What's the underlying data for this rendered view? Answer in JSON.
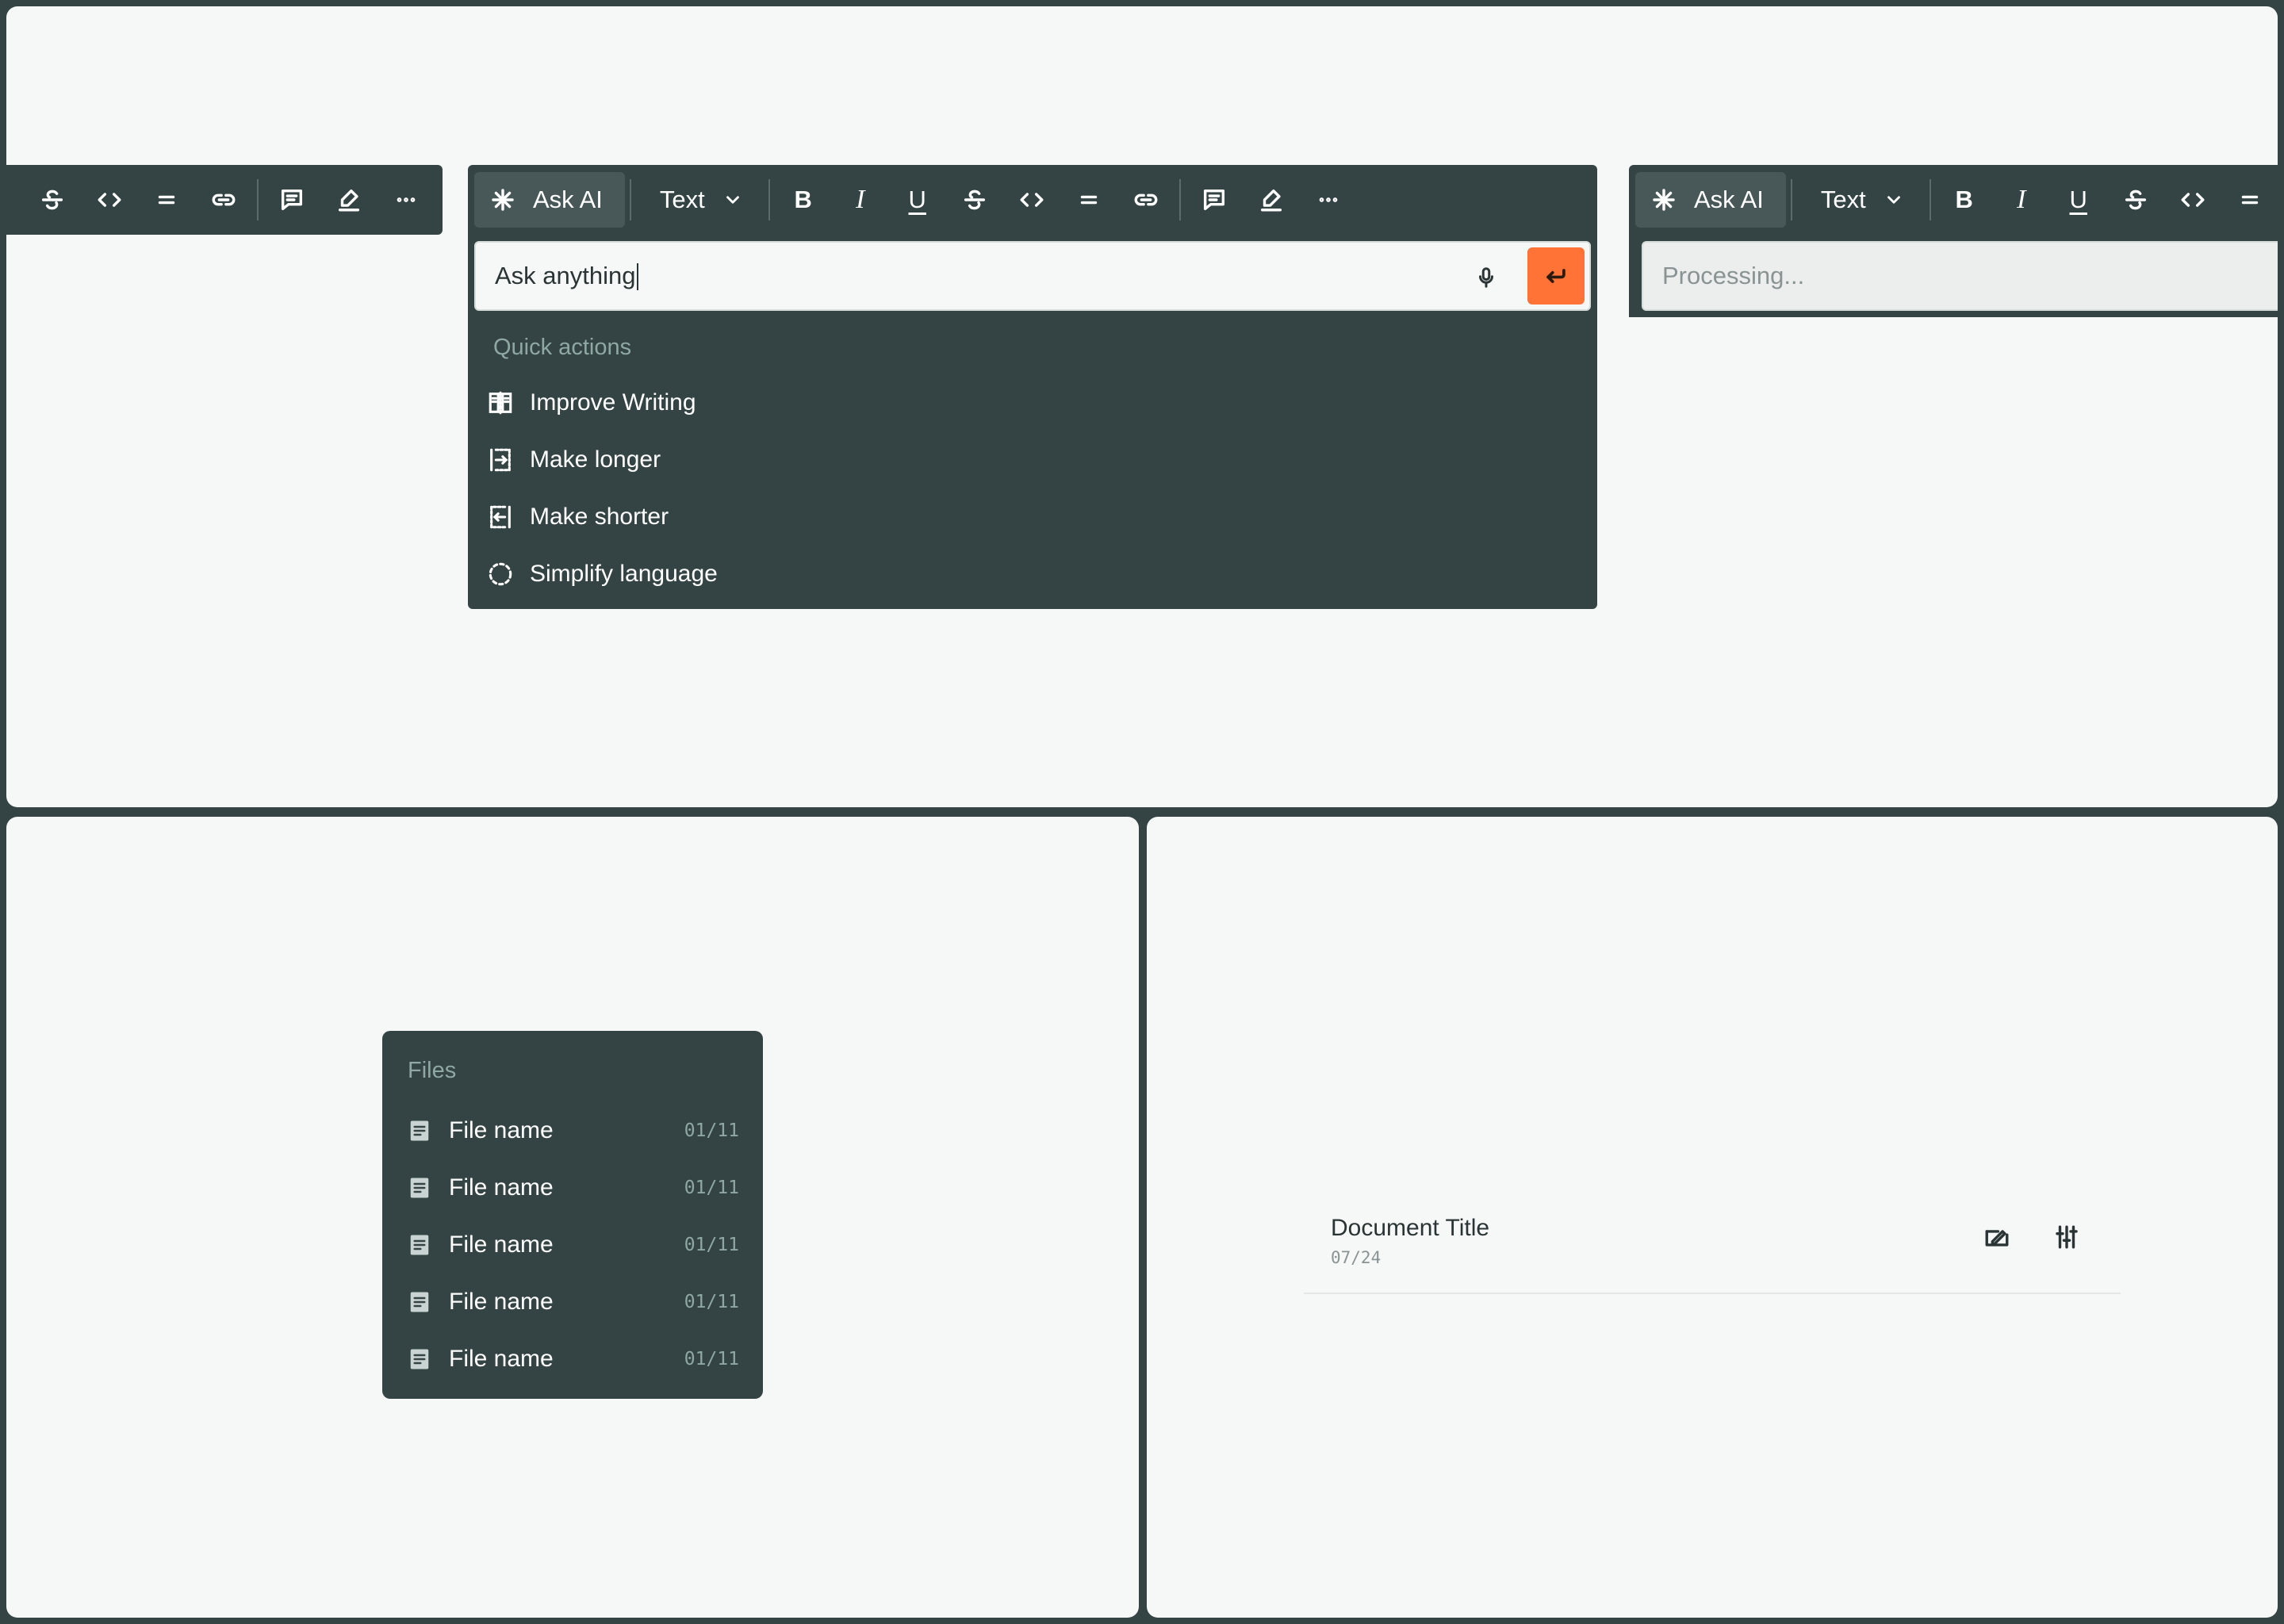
{
  "toolbar": {
    "ask_ai_label": "Ask AI",
    "text_style_label": "Text"
  },
  "ai_prompt": {
    "input_value": "Ask anything",
    "quick_actions_heading": "Quick actions",
    "quick_actions": [
      {
        "label": "Improve Writing",
        "icon": "book-open-icon"
      },
      {
        "label": "Make longer",
        "icon": "expand-text-icon"
      },
      {
        "label": "Make shorter",
        "icon": "shorten-text-icon"
      },
      {
        "label": "Simplify language",
        "icon": "dashed-circle-icon"
      }
    ],
    "send_color": "#ff7336"
  },
  "processing": {
    "placeholder": "Processing..."
  },
  "files": {
    "heading": "Files",
    "items": [
      {
        "name": "File name",
        "date": "01/11"
      },
      {
        "name": "File name",
        "date": "01/11"
      },
      {
        "name": "File name",
        "date": "01/11"
      },
      {
        "name": "File name",
        "date": "01/11"
      },
      {
        "name": "File name",
        "date": "01/11"
      }
    ]
  },
  "document": {
    "title": "Document Title",
    "date": "07/24"
  },
  "colors": {
    "background": "#344444",
    "panel": "#f6f8f7",
    "accent": "#ff7336",
    "muted": "#8fa8a4"
  }
}
